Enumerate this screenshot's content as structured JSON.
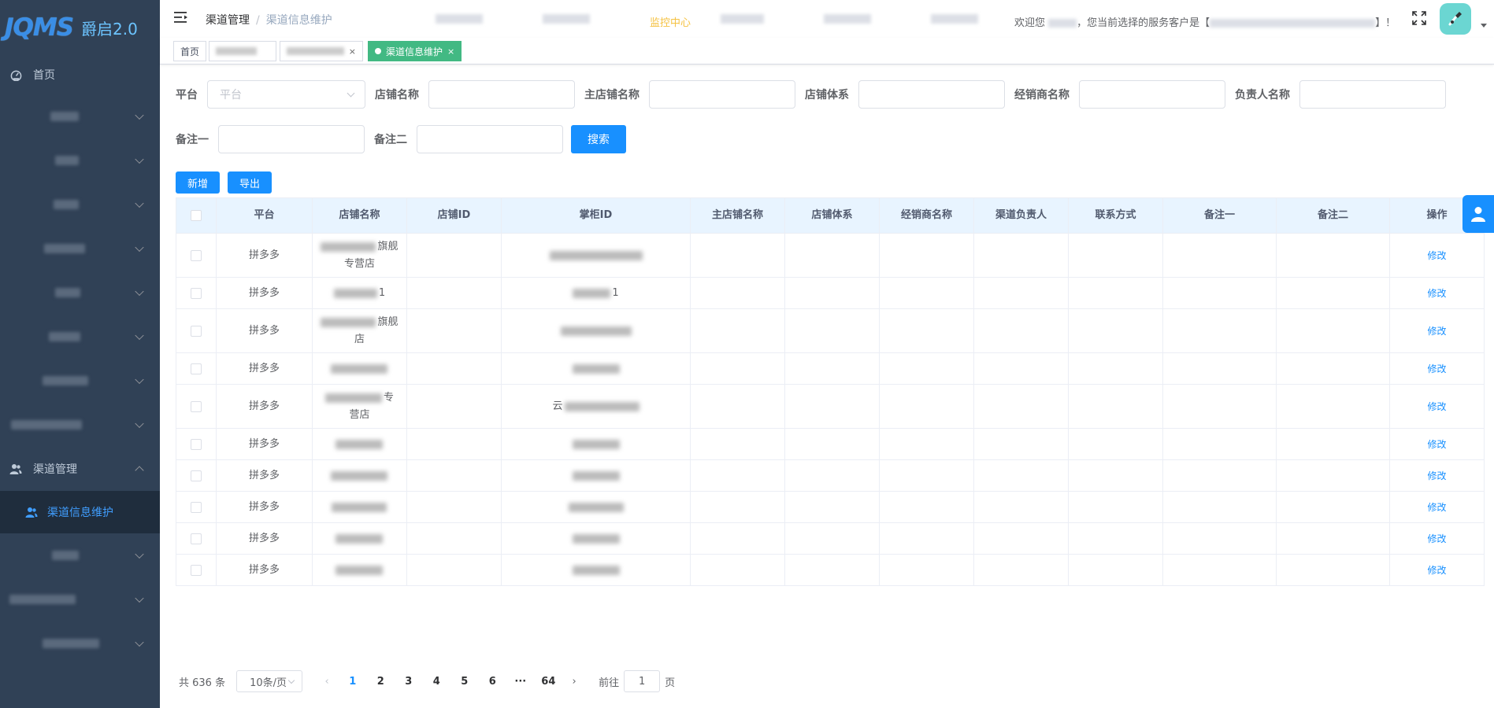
{
  "logo": {
    "mark": "JQMS",
    "text": "爵启2.0"
  },
  "sidebar": {
    "items": [
      {
        "label": "首页",
        "icon": "dashboard-icon"
      },
      {
        "label": "",
        "w": 0
      },
      {
        "label": ""
      },
      {
        "label": ""
      },
      {
        "label": ""
      },
      {
        "label": ""
      },
      {
        "label": ""
      },
      {
        "label": ""
      },
      {
        "label": ""
      }
    ],
    "group": {
      "label": "渠道管理",
      "icon": "user-group-icon",
      "child": "渠道信息维护"
    },
    "after": [
      {
        "label": ""
      },
      {
        "label": ""
      },
      {
        "label": ""
      }
    ]
  },
  "header": {
    "breadcrumb_main": "渠道管理",
    "breadcrumb_sep": "/",
    "breadcrumb_current": "渠道信息维护",
    "nav_active": "监控中心",
    "welcome_prefix": "欢迎您",
    "welcome_middle": "，您当前选择的服务客户是【",
    "welcome_suffix": "】！"
  },
  "tags": {
    "home": "首页",
    "active": "渠道信息维护",
    "close": "×"
  },
  "form": {
    "platform_label": "平台",
    "platform_placeholder": "平台",
    "shop_name_label": "店铺名称",
    "main_shop_label": "主店铺名称",
    "shop_system_label": "店铺体系",
    "dealer_label": "经销商名称",
    "owner_label": "负责人名称",
    "note1_label": "备注一",
    "note2_label": "备注二",
    "search_button": "搜索",
    "add_button": "新增",
    "export_button": "导出"
  },
  "table": {
    "headers": [
      "平台",
      "店铺名称",
      "店铺ID",
      "掌柜ID",
      "主店铺名称",
      "店铺体系",
      "经销商名称",
      "渠道负责人",
      "联系方式",
      "备注一",
      "备注二",
      "操作"
    ],
    "rows": [
      {
        "platform": "拼多多",
        "shop_line1": "",
        "shop_line1_tail": "旗舰",
        "shop_line2": "专营店",
        "shop_id": "",
        "keeper": "",
        "action": "修改"
      },
      {
        "platform": "拼多多",
        "shop_line1": "",
        "shop_line1_tail": "1",
        "shop_line2": "",
        "shop_id": "",
        "keeper_tail": "1",
        "action": "修改"
      },
      {
        "platform": "拼多多",
        "shop_line1": "",
        "shop_line1_tail": "旗舰",
        "shop_line2": "店",
        "shop_id": "",
        "action": "修改"
      },
      {
        "platform": "拼多多",
        "shop_line1": "",
        "shop_line1_tail": "",
        "shop_line2": "",
        "shop_id": "",
        "action": "修改"
      },
      {
        "platform": "拼多多",
        "shop_line1": "",
        "shop_line1_tail": "专",
        "shop_line2": "营店",
        "shop_id": "",
        "keeper_head": "云",
        "action": "修改"
      },
      {
        "platform": "拼多多",
        "shop_line1": "",
        "shop_line1_tail": "",
        "shop_line2": "",
        "shop_id": "",
        "action": "修改"
      },
      {
        "platform": "拼多多",
        "shop_line1": "",
        "shop_line1_tail": "",
        "shop_line2": "",
        "shop_id": "",
        "action": "修改"
      },
      {
        "platform": "拼多多",
        "shop_line1": "",
        "shop_line1_tail": "",
        "shop_line2": "",
        "shop_id": "",
        "action": "修改"
      },
      {
        "platform": "拼多多",
        "shop_line1": "",
        "shop_line1_tail": "",
        "shop_line2": "",
        "shop_id": "",
        "action": "修改"
      },
      {
        "platform": "拼多多",
        "shop_line1": "",
        "shop_line1_tail": "",
        "shop_line2": "",
        "shop_id": "",
        "action": "修改"
      }
    ]
  },
  "pagination": {
    "total": "共 636 条",
    "page_size": "10条/页",
    "prev": "‹",
    "pages": [
      "1",
      "2",
      "3",
      "4",
      "5",
      "6",
      "···",
      "64"
    ],
    "current": "1",
    "next": "›",
    "goto_prefix": "前往",
    "goto_value": "1",
    "goto_suffix": "页"
  },
  "colors": {
    "sidebar_bg": "#304156",
    "primary": "#1890ff",
    "active_tag": "#42b983",
    "nav_active": "#f5c242"
  }
}
